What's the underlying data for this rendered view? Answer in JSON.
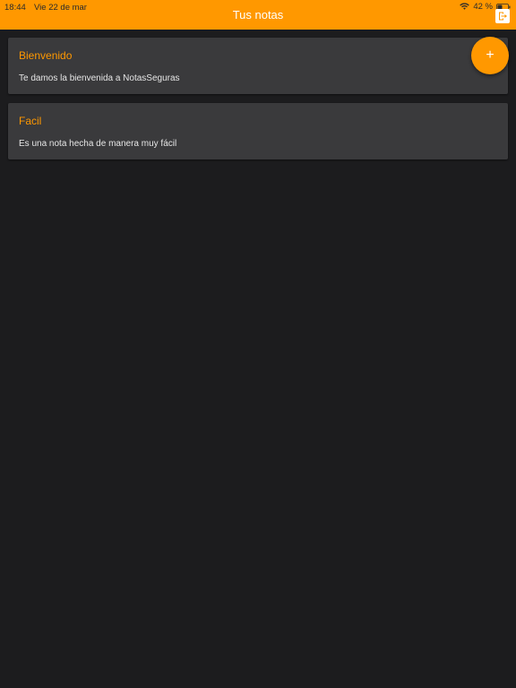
{
  "status_bar": {
    "time": "18:44",
    "date": "Vie 22 de mar",
    "battery": "42 %"
  },
  "header": {
    "title": "Tus notas"
  },
  "fab": {
    "label": "+"
  },
  "notes": [
    {
      "title": "Bienvenido",
      "body": "Te damos la bienvenida a NotasSeguras"
    },
    {
      "title": "Facil",
      "body": "Es una nota hecha de manera muy fácil"
    }
  ],
  "colors": {
    "accent": "#ff9800",
    "background": "#1c1c1e",
    "card": "#3a3a3c"
  }
}
